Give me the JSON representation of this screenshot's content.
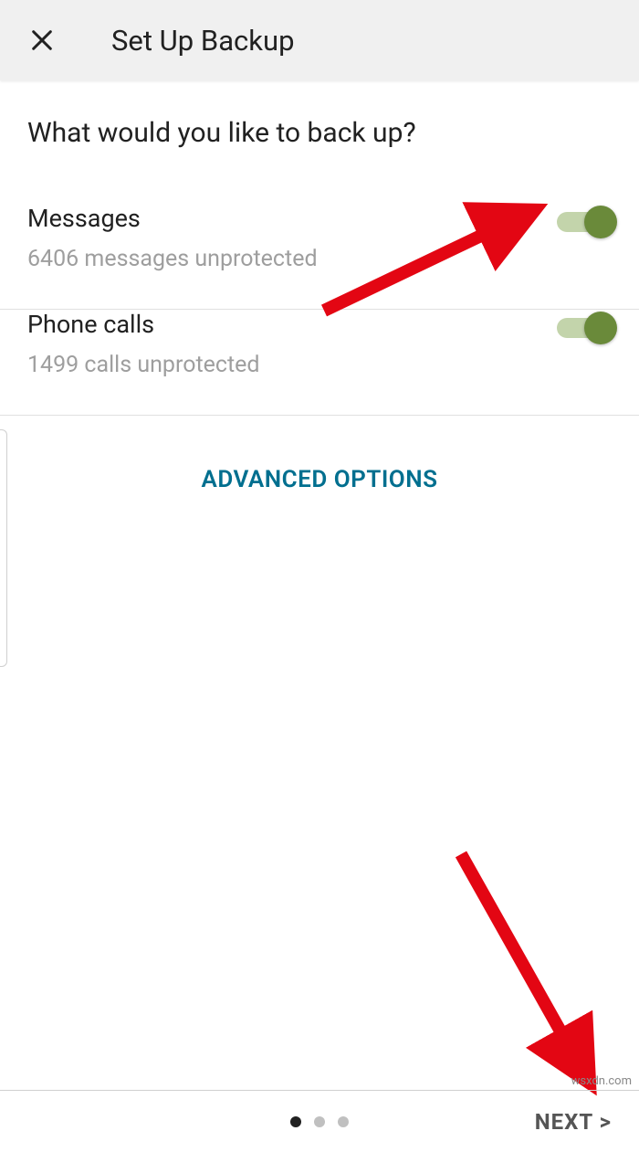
{
  "header": {
    "title": "Set Up Backup"
  },
  "question": "What would you like to back up?",
  "options": {
    "messages": {
      "title": "Messages",
      "subtitle": "6406 messages unprotected",
      "enabled": true
    },
    "calls": {
      "title": "Phone calls",
      "subtitle": "1499 calls unprotected",
      "enabled": true
    }
  },
  "advanced_label": "ADVANCED OPTIONS",
  "next_label": "NEXT >",
  "watermark": "wsxdn.com",
  "colors": {
    "accent_toggle": "#6a8a3a",
    "link": "#006f8f",
    "arrow": "#e30613"
  }
}
